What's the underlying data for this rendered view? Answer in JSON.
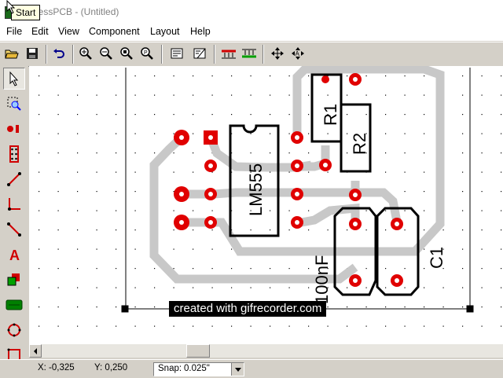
{
  "window": {
    "title": "ExpressPCB - (Untitled)",
    "tooltip": "Start"
  },
  "menu": [
    "File",
    "Edit",
    "View",
    "Component",
    "Layout",
    "Help"
  ],
  "toolbar": {
    "buttons": [
      "open-icon",
      "save-icon",
      "undo-icon",
      "zoom-in-icon",
      "zoom-out-icon",
      "zoom-fit-icon",
      "zoom-window-icon",
      "component-properties-icon",
      "pcb-properties-icon",
      "top-layer-icon",
      "bottom-layer-icon",
      "move-icon",
      "rotate-icon"
    ]
  },
  "left_tools": [
    "select-tool-icon",
    "zoom-region-icon",
    "pad-tool-icon",
    "component-tool-icon",
    "trace-tool-icon",
    "corner-tool-icon",
    "diagonal-tool-icon",
    "text-tool-icon",
    "shapes-tool-icon",
    "connector-tool-icon",
    "circle-tool-icon",
    "rectangle-tool-icon",
    "part-tool-icon"
  ],
  "board": {
    "labels": {
      "ic": "LM555",
      "r1": "R1",
      "r2": "R2",
      "cap_value": "100nF",
      "c1": "C1"
    },
    "watermark": "created with gifrecorder.com",
    "colors": {
      "pad": "#e00000",
      "trace": "#c8c8c8",
      "silkscreen": "#000000"
    }
  },
  "status": {
    "x": "X: -0,325",
    "y": "Y: 0,250",
    "snap_label": "Snap:",
    "snap_value": "0.025\""
  }
}
